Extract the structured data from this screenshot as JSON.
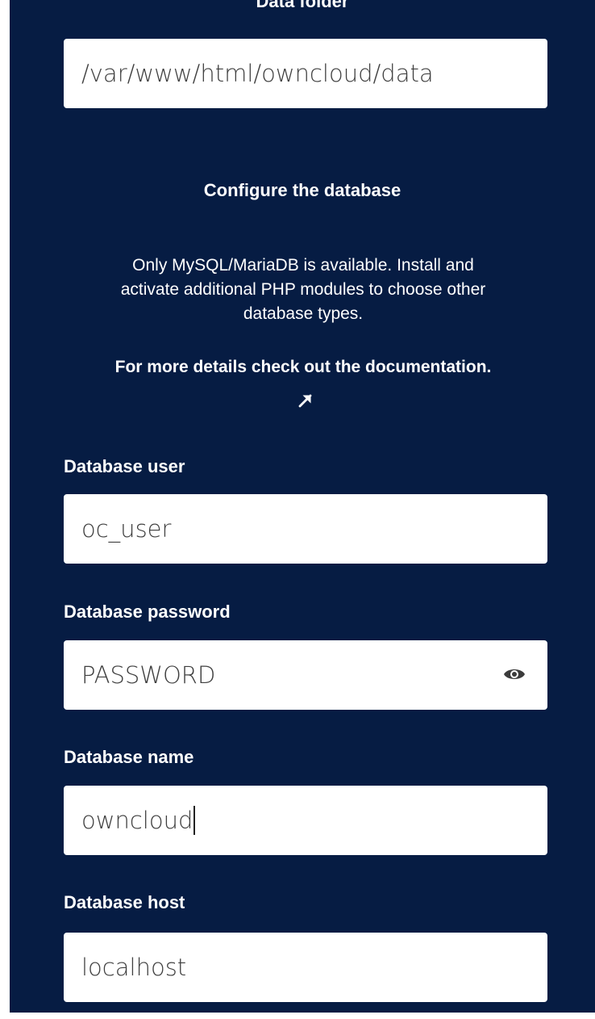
{
  "data_folder": {
    "title": "Data folder",
    "value": "/var/www/html/owncloud/data"
  },
  "database": {
    "title": "Configure the database",
    "info_lines": [
      "Only MySQL/MariaDB is available. Install and",
      "activate additional PHP modules to choose other",
      "database types."
    ],
    "doc_link": "For more details check out the documentation.",
    "doc_link_icon": "external-link-arrow-icon"
  },
  "fields": {
    "user": {
      "label": "Database user",
      "value": "oc_user"
    },
    "password": {
      "label": "Database password",
      "value": "PASSWORD",
      "toggle_icon": "eye-icon"
    },
    "name": {
      "label": "Database name",
      "value": "owncloud"
    },
    "host": {
      "label": "Database host",
      "value": "localhost"
    }
  },
  "colors": {
    "background": "#061c43",
    "input_background": "#ffffff",
    "text": "#ffffff",
    "input_text": "#3f3f3f"
  }
}
